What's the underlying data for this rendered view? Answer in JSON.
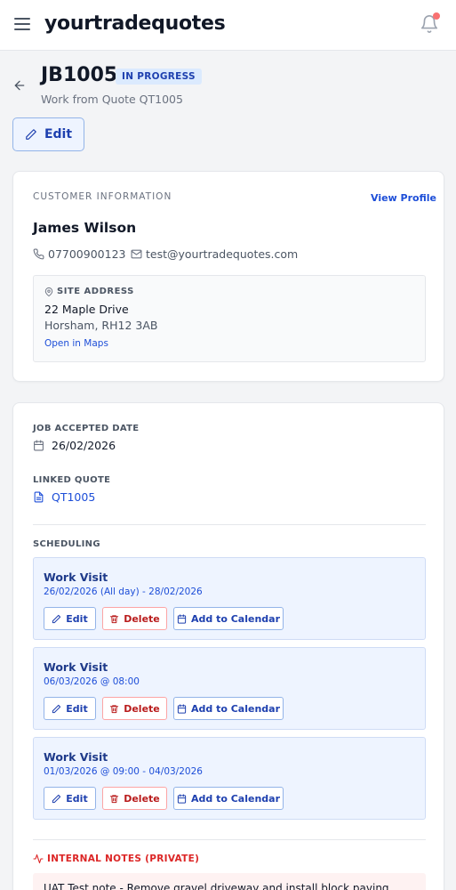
{
  "app": {
    "title": "yourtradequotes"
  },
  "job": {
    "id": "JB1005",
    "status": "IN PROGRESS",
    "subtitle": "Work from Quote QT1005",
    "edit_label": "Edit"
  },
  "customer": {
    "section_label": "CUSTOMER INFORMATION",
    "view_profile": "View Profile",
    "name": "James Wilson",
    "phone": "07700900123",
    "email": "test@yourtradequotes.com",
    "site": {
      "label": "SITE ADDRESS",
      "line1": "22 Maple Drive",
      "line2": "Horsham, RH12 3AB",
      "maps_link": "Open in Maps"
    }
  },
  "details": {
    "accepted_label": "JOB ACCEPTED DATE",
    "accepted_date": "26/02/2026",
    "linked_label": "LINKED QUOTE",
    "linked_quote": "QT1005",
    "scheduling_label": "SCHEDULING",
    "visits": [
      {
        "title": "Work Visit",
        "date": "26/02/2026 (All day) - 28/02/2026",
        "edit": "Edit",
        "delete": "Delete",
        "calendar": "Add to Calendar"
      },
      {
        "title": "Work Visit",
        "date": "06/03/2026 @ 08:00",
        "edit": "Edit",
        "delete": "Delete",
        "calendar": "Add to Calendar"
      },
      {
        "title": "Work Visit",
        "date": "01/03/2026 @ 09:00 - 04/03/2026",
        "edit": "Edit",
        "delete": "Delete",
        "calendar": "Add to Calendar"
      }
    ],
    "notes_label": "INTERNAL NOTES (PRIVATE)",
    "notes_text": "UAT Test note - Remove gravel driveway and install block paving"
  },
  "colors": {
    "accent": "#1d4ed8",
    "badge_bg": "#dbeafe",
    "danger": "#dc2626",
    "notification_dot": "#f87171"
  },
  "icons": [
    "menu-icon",
    "bell-icon",
    "arrow-left-icon",
    "pencil-icon",
    "phone-icon",
    "mail-icon",
    "map-pin-icon",
    "calendar-icon",
    "file-icon",
    "trash-icon",
    "activity-icon"
  ]
}
